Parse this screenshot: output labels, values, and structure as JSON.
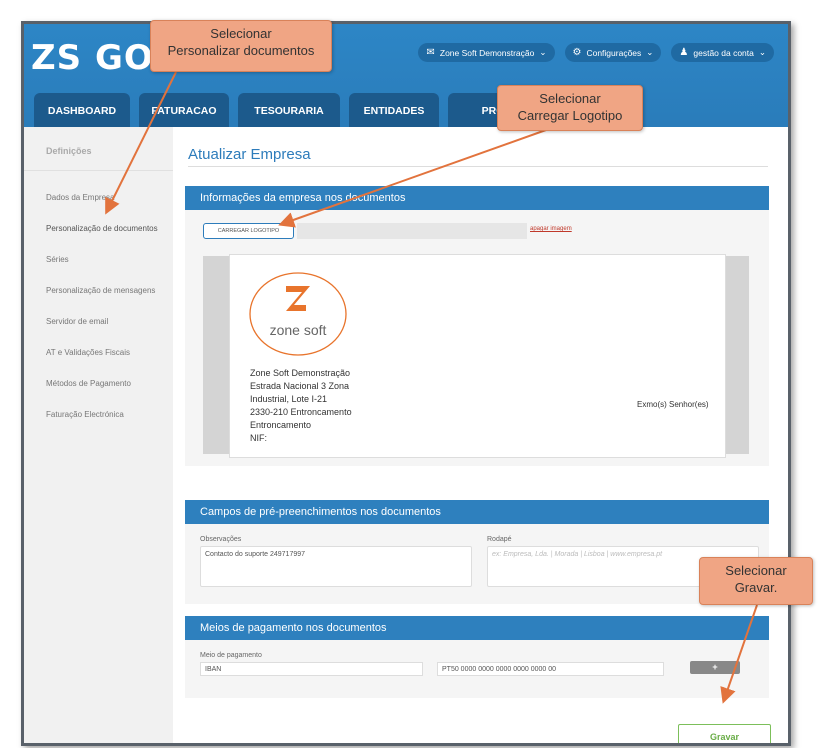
{
  "app": {
    "logo_text": "ZS GO"
  },
  "topnav": {
    "company": "Zone Soft Demonstração",
    "settings": "Configurações",
    "account": "gestão da conta",
    "chevron": "⌄"
  },
  "tabs": [
    "DASHBOARD",
    "FATURACAO",
    "TESOURARIA",
    "ENTIDADES",
    "PRO"
  ],
  "sidebar": {
    "heading": "Definições",
    "items": [
      "Dados da Empresa",
      "Personalização de documentos",
      "Séries",
      "Personalização de mensagens",
      "Servidor de email",
      "AT e Validações Fiscais",
      "Métodos de Pagamento",
      "Faturação Electrónica"
    ]
  },
  "main": {
    "title": "Atualizar Empresa",
    "section1": {
      "title": "Informações da empresa nos documentos",
      "upload_button": "CARREGAR LOGOTIPO",
      "delete_link": "apagar imagem"
    },
    "preview": {
      "logo_text": "zone soft",
      "address_lines": [
        "Zone Soft Demonstração",
        "Estrada Nacional 3 Zona",
        "Industrial, Lote I-21",
        "2330-210 Entroncamento",
        "Entroncamento",
        "NIF:"
      ],
      "greeting": "Exmo(s) Senhor(es)"
    },
    "section2": {
      "title": "Campos de pré-preenchimentos nos documentos",
      "observacoes_label": "Observações",
      "observacoes_value": "Contacto do suporte 249717997",
      "rodape_label": "Rodapé",
      "rodape_placeholder": "ex: Empresa, Lda. | Morada | Lisboa | www.empresa.pt"
    },
    "section3": {
      "title": "Meios de pagamento nos documentos",
      "method_label": "Meio de pagamento",
      "method_value": "IBAN",
      "iban_value": "PT50 0000 0000 0000 0000 0000 00",
      "add_button": "+"
    },
    "save_button": "Gravar"
  },
  "callouts": {
    "personalizar": "Selecionar\nPersonalizar documentos",
    "carregar": "Selecionar\nCarregar Logotipo",
    "gravar": "Selecionar\nGravar."
  },
  "colors": {
    "primary": "#2d80be",
    "tab": "#1c5a8c",
    "callout": "#f0a584",
    "arrow": "#e2733d",
    "logo_orange": "#e8742c",
    "save_green": "#6aad47"
  }
}
